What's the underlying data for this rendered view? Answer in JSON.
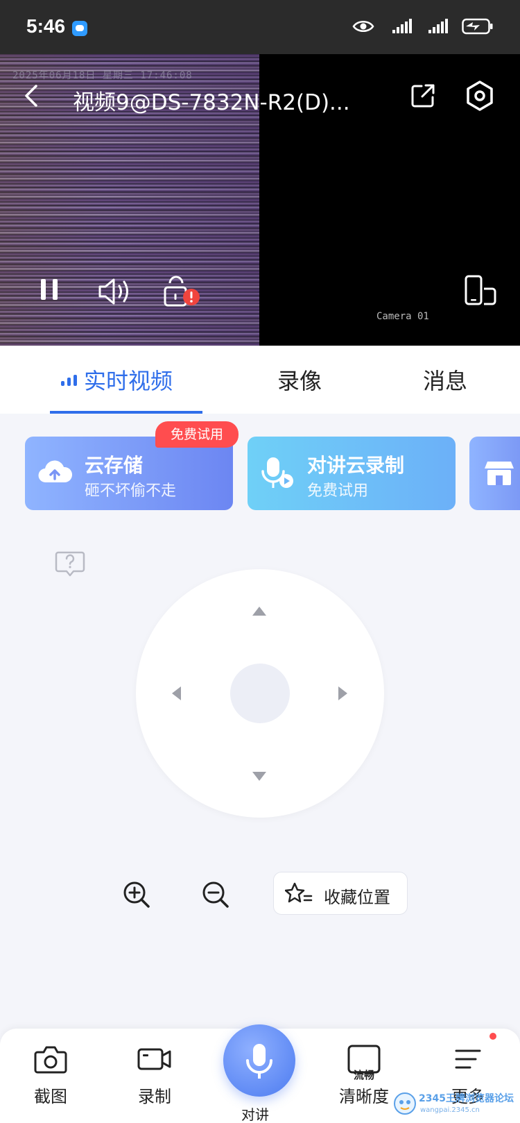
{
  "status_bar": {
    "time": "5:46",
    "icons": [
      "chat-notification-icon",
      "eye-icon",
      "signal-icon",
      "signal-icon",
      "battery-charging-icon"
    ]
  },
  "video": {
    "title": "视频9@DS-7832N-R2(D)...",
    "overlay_timestamp": "2025年06月18日 星期三 17:46:08",
    "camera_label": "Camera 01"
  },
  "tabs": [
    {
      "label": "实时视频",
      "active": true
    },
    {
      "label": "录像",
      "active": false
    },
    {
      "label": "消息",
      "active": false
    }
  ],
  "banners": {
    "cloud": {
      "title": "云存储",
      "subtitle": "砸不坏偷不走",
      "badge": "免费试用"
    },
    "talk": {
      "title": "对讲云录制",
      "subtitle": "免费试用"
    }
  },
  "ptz": {
    "favorite_label": "收藏位置"
  },
  "bottom_bar": {
    "screenshot": "截图",
    "record": "录制",
    "talk": "对讲",
    "quality": "清晰度",
    "quality_badge": "流畅",
    "more": "更多"
  },
  "watermark": {
    "text": "2345王牌浏览器论坛",
    "url": "wangpai.2345.cn"
  },
  "colors": {
    "accent": "#2f6eea",
    "badge_red": "#ff4d4f"
  }
}
